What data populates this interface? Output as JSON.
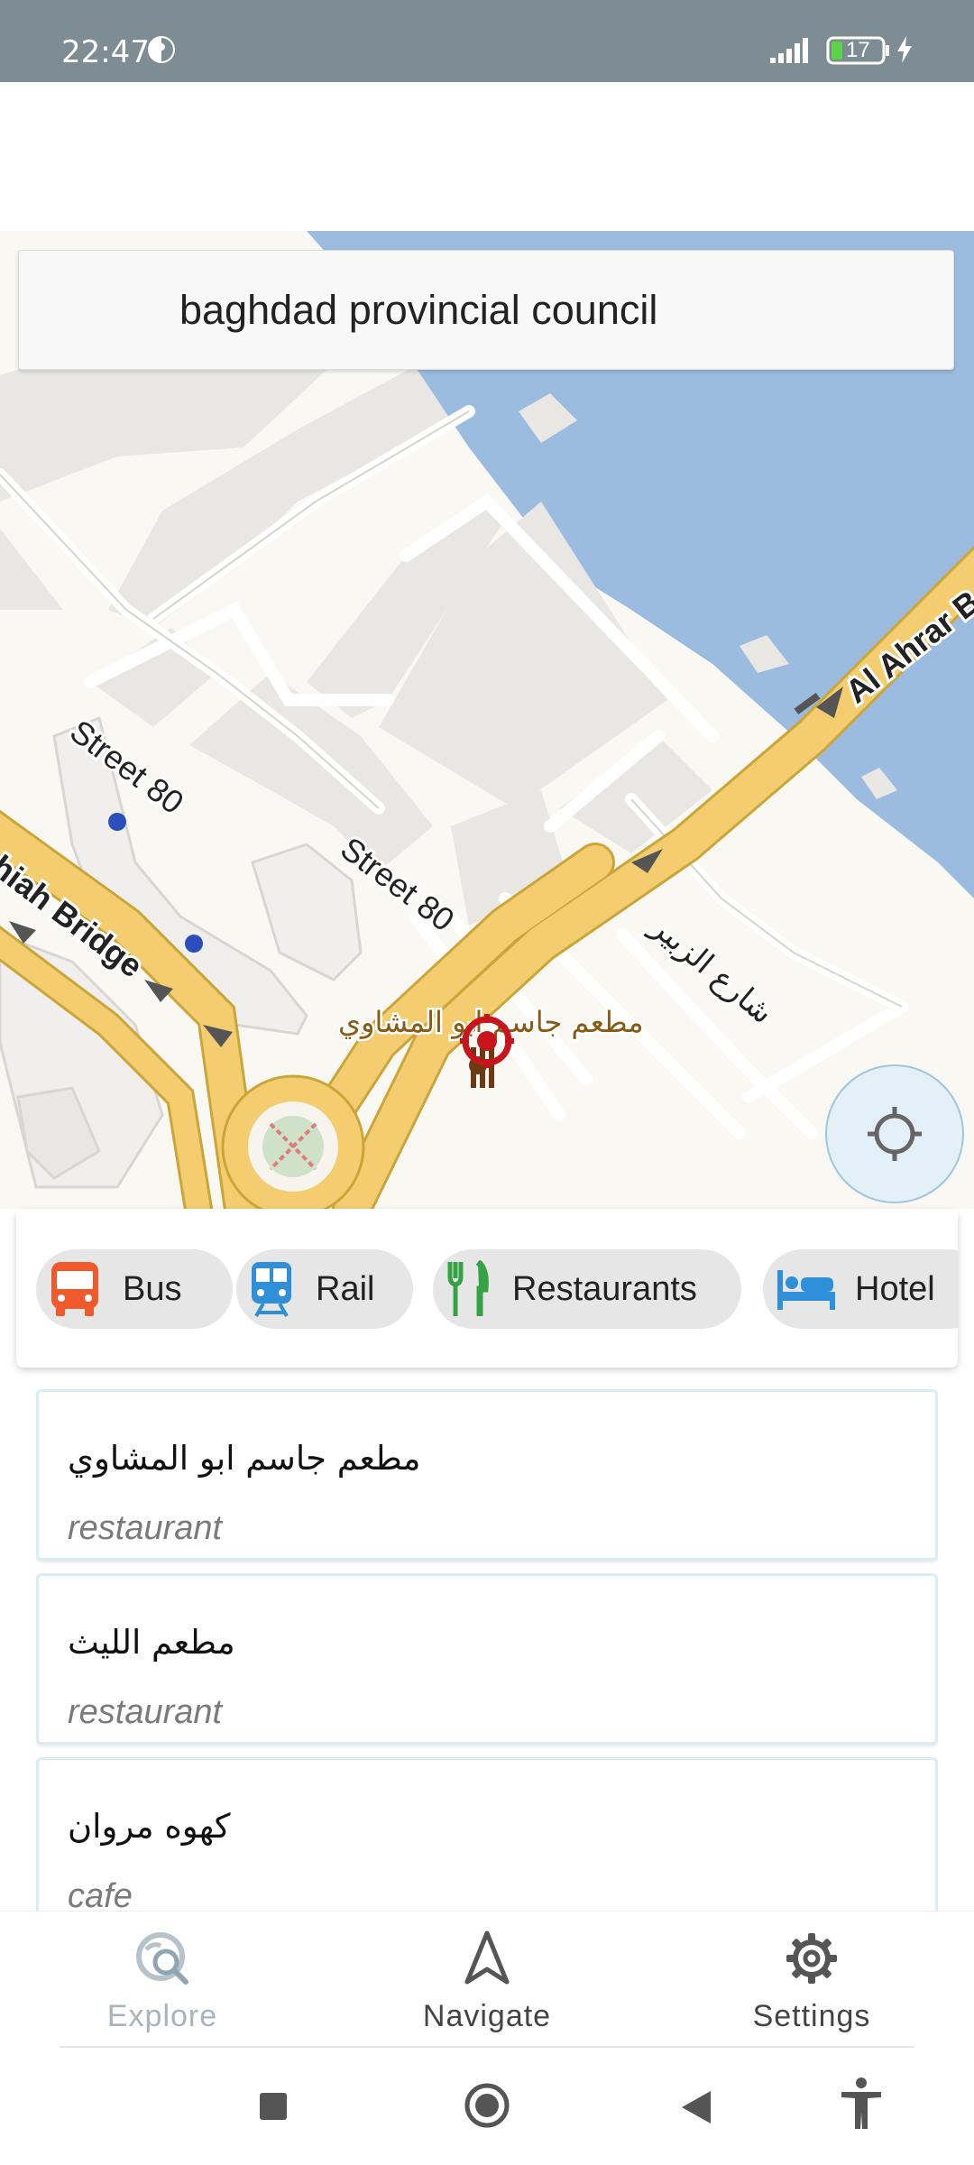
{
  "status_bar": {
    "time": "22:47",
    "battery": "17",
    "icons": [
      "signal-icon",
      "battery-icon",
      "charging-icon",
      "data-saver-icon"
    ]
  },
  "search": {
    "query": "baghdad provincial council"
  },
  "map": {
    "labels": {
      "street80_a": "Street 80",
      "street80_b": "Street 80",
      "bridge": "hiah Bridge",
      "ahrar": "Al Ahrar B",
      "zubair": "شارع الزبير",
      "restaurant_poi": "مطعم جاسم ابو المشاوي"
    },
    "colors": {
      "water": "#9bbbdf",
      "road": "#f3cd6f",
      "block": "#e8e7e4",
      "poi": "#c8141c"
    }
  },
  "categories": [
    {
      "label": "Bus",
      "icon": "bus-icon",
      "color": "#f0592b"
    },
    {
      "label": "Rail",
      "icon": "train-icon",
      "color": "#2f8fd9"
    },
    {
      "label": "Restaurants",
      "icon": "fork-knife-icon",
      "color": "#35a345"
    },
    {
      "label": "Hotel",
      "icon": "bed-icon",
      "color": "#2f8fd9"
    }
  ],
  "results": [
    {
      "name": "مطعم جاسم ابو المشاوي",
      "kind": "restaurant"
    },
    {
      "name": "مطعم الليث",
      "kind": "restaurant"
    },
    {
      "name": "كهوه مروان",
      "kind": "cafe"
    }
  ],
  "nav": {
    "explore": "Explore",
    "navigate": "Navigate",
    "settings": "Settings",
    "active": "explore"
  }
}
